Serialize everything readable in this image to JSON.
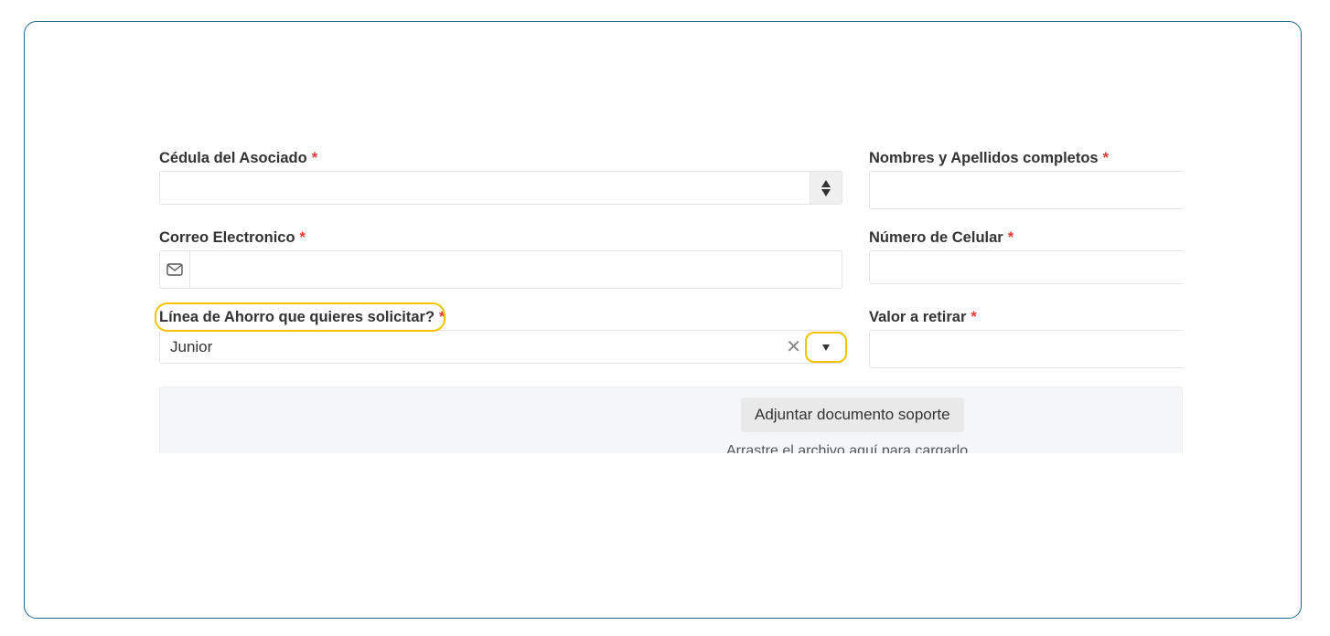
{
  "form": {
    "required_marker": "*",
    "cedula": {
      "label": "Cédula del Asociado",
      "value": ""
    },
    "nombres": {
      "label": "Nombres y Apellidos completos",
      "value": ""
    },
    "correo": {
      "label": "Correo Electronico",
      "value": "",
      "icon": "envelope-icon"
    },
    "celular": {
      "label": "Número de Celular",
      "value": ""
    },
    "linea": {
      "label": "Línea de Ahorro que quieres solicitar?",
      "value": "Junior",
      "clear_glyph": "✕"
    },
    "valor": {
      "label": "Valor a retirar",
      "value": ""
    },
    "upload": {
      "button_label": "Adjuntar documento soporte",
      "hint": "Arrastre el archivo aquí para cargarlo"
    }
  },
  "colors": {
    "frame_border": "#1f6b8c",
    "highlight": "#f2c300",
    "required": "#e53935"
  }
}
